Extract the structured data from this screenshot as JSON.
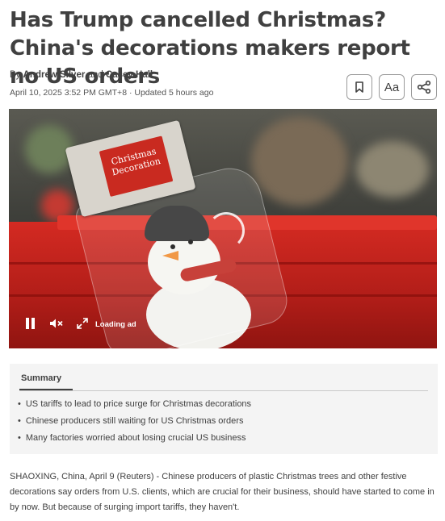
{
  "article": {
    "headline": "Has Trump cancelled Christmas? China's decorations makers report no US orders",
    "byline_prefix": "By",
    "authors": [
      "Andrew Silver",
      "Casey Hall"
    ],
    "byline_joiner": "and",
    "dateline": "April 10, 2025 3:52 PM GMT+8 · Updated 5 hours ago"
  },
  "toolbar": {
    "bookmark_icon": "bookmark-icon",
    "text_size_label": "Aa",
    "share_icon": "share-icon"
  },
  "video": {
    "tag_text": "Christmas Decoration",
    "loading_label": "Loading ad",
    "controls": [
      "pause-icon",
      "mute-icon",
      "fullscreen-icon"
    ]
  },
  "summary": {
    "title": "Summary",
    "items": [
      "US tariffs to lead to price surge for Christmas decorations",
      "Chinese producers still waiting for US Christmas orders",
      "Many factories worried about losing crucial US business"
    ]
  },
  "body": {
    "lead": "SHAOXING, China, April 9 (Reuters) - Chinese producers of plastic Christmas trees and other festive decorations say orders from U.S. clients, which are crucial for their business, should have started to come in by now. But because of surging import tariffs, they haven't."
  }
}
